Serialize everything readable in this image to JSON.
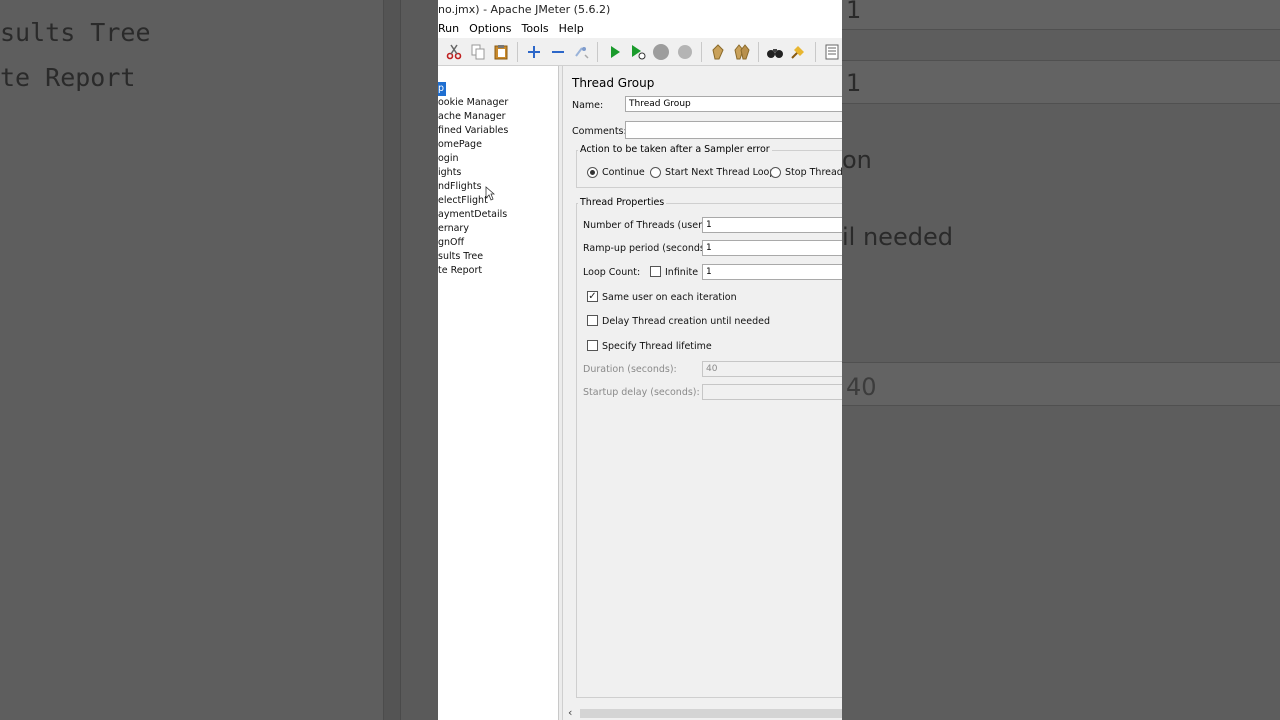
{
  "window": {
    "title": "no.jmx) - Apache JMeter (5.6.2)"
  },
  "menu": [
    "Run",
    "Options",
    "Tools",
    "Help"
  ],
  "toolbar_icons": [
    "cut-icon",
    "copy-icon",
    "paste-icon",
    "add-icon",
    "remove-icon",
    "toggle-icon",
    "start-icon",
    "start-no-timers-icon",
    "stop-icon",
    "shutdown-icon",
    "clear-icon",
    "clear-all-icon",
    "search-icon",
    "reset-search-icon",
    "function-helper-icon"
  ],
  "tree": [
    {
      "label": "p",
      "selected": true
    },
    {
      "label": "ookie Manager"
    },
    {
      "label": "ache Manager"
    },
    {
      "label": "fined Variables"
    },
    {
      "label": "omePage"
    },
    {
      "label": "ogin"
    },
    {
      "label": "ights"
    },
    {
      "label": "ndFlights"
    },
    {
      "label": "electFlight"
    },
    {
      "label": "aymentDetails"
    },
    {
      "label": "ernary"
    },
    {
      "label": "gnOff"
    },
    {
      "label": "sults Tree"
    },
    {
      "label": "te Report"
    }
  ],
  "panel": {
    "title": "Thread Group",
    "name_label": "Name:",
    "name_value": "Thread Group",
    "comments_label": "Comments:",
    "comments_value": "",
    "sampler_error": {
      "title": "Action to be taken after a Sampler error",
      "options": [
        "Continue",
        "Start Next Thread Loop",
        "Stop Thread"
      ],
      "selected": "Continue"
    },
    "thread_props": {
      "title": "Thread Properties",
      "threads_label": "Number of Threads (users):",
      "threads_value": "1",
      "rampup_label": "Ramp-up period (seconds):",
      "rampup_value": "1",
      "loop_label": "Loop Count:",
      "infinite_label": "Infinite",
      "loop_value": "1",
      "same_user_label": "Same user on each iteration",
      "delay_label": "Delay Thread creation until needed",
      "lifetime_label": "Specify Thread lifetime",
      "duration_label": "Duration (seconds):",
      "duration_value": "40",
      "startup_label": "Startup delay (seconds):",
      "startup_value": ""
    }
  },
  "background": {
    "left_lines": [
      "sults Tree",
      "te Report"
    ],
    "right_lines": [
      "1",
      "1",
      "on",
      "il needed",
      "40"
    ]
  }
}
